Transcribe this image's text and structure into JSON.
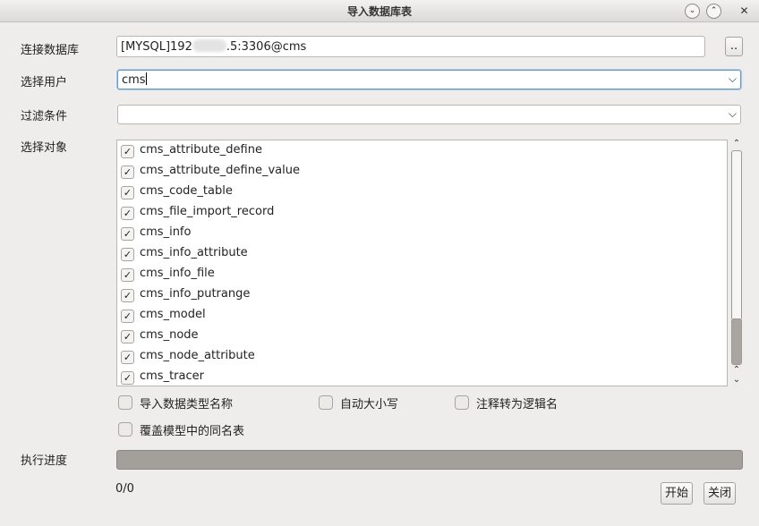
{
  "window": {
    "title": "导入数据库表"
  },
  "labels": {
    "connect_db": "连接数据库",
    "select_user": "选择用户",
    "filter": "过滤条件",
    "select_objects": "选择对象",
    "progress": "执行进度"
  },
  "connection": {
    "value_prefix": "[MYSQL]192",
    "value_suffix": ".5:3306@cms",
    "browse_label": ".."
  },
  "user": {
    "value": "cms"
  },
  "filter": {
    "value": ""
  },
  "objects": [
    {
      "name": "cms_attribute_define",
      "checked": true
    },
    {
      "name": "cms_attribute_define_value",
      "checked": true
    },
    {
      "name": "cms_code_table",
      "checked": true
    },
    {
      "name": "cms_file_import_record",
      "checked": true
    },
    {
      "name": "cms_info",
      "checked": true
    },
    {
      "name": "cms_info_attribute",
      "checked": true
    },
    {
      "name": "cms_info_file",
      "checked": true
    },
    {
      "name": "cms_info_putrange",
      "checked": true
    },
    {
      "name": "cms_model",
      "checked": true
    },
    {
      "name": "cms_node",
      "checked": true
    },
    {
      "name": "cms_node_attribute",
      "checked": true
    },
    {
      "name": "cms_tracer",
      "checked": true
    }
  ],
  "options": {
    "import_type_name": "导入数据类型名称",
    "auto_case": "自动大小写",
    "comment_to_logic": "注释转为逻辑名",
    "overwrite_same_name": "覆盖模型中的同名表"
  },
  "progress": {
    "text": "0/0",
    "fraction": 0
  },
  "buttons": {
    "start": "开始",
    "close": "关闭"
  }
}
